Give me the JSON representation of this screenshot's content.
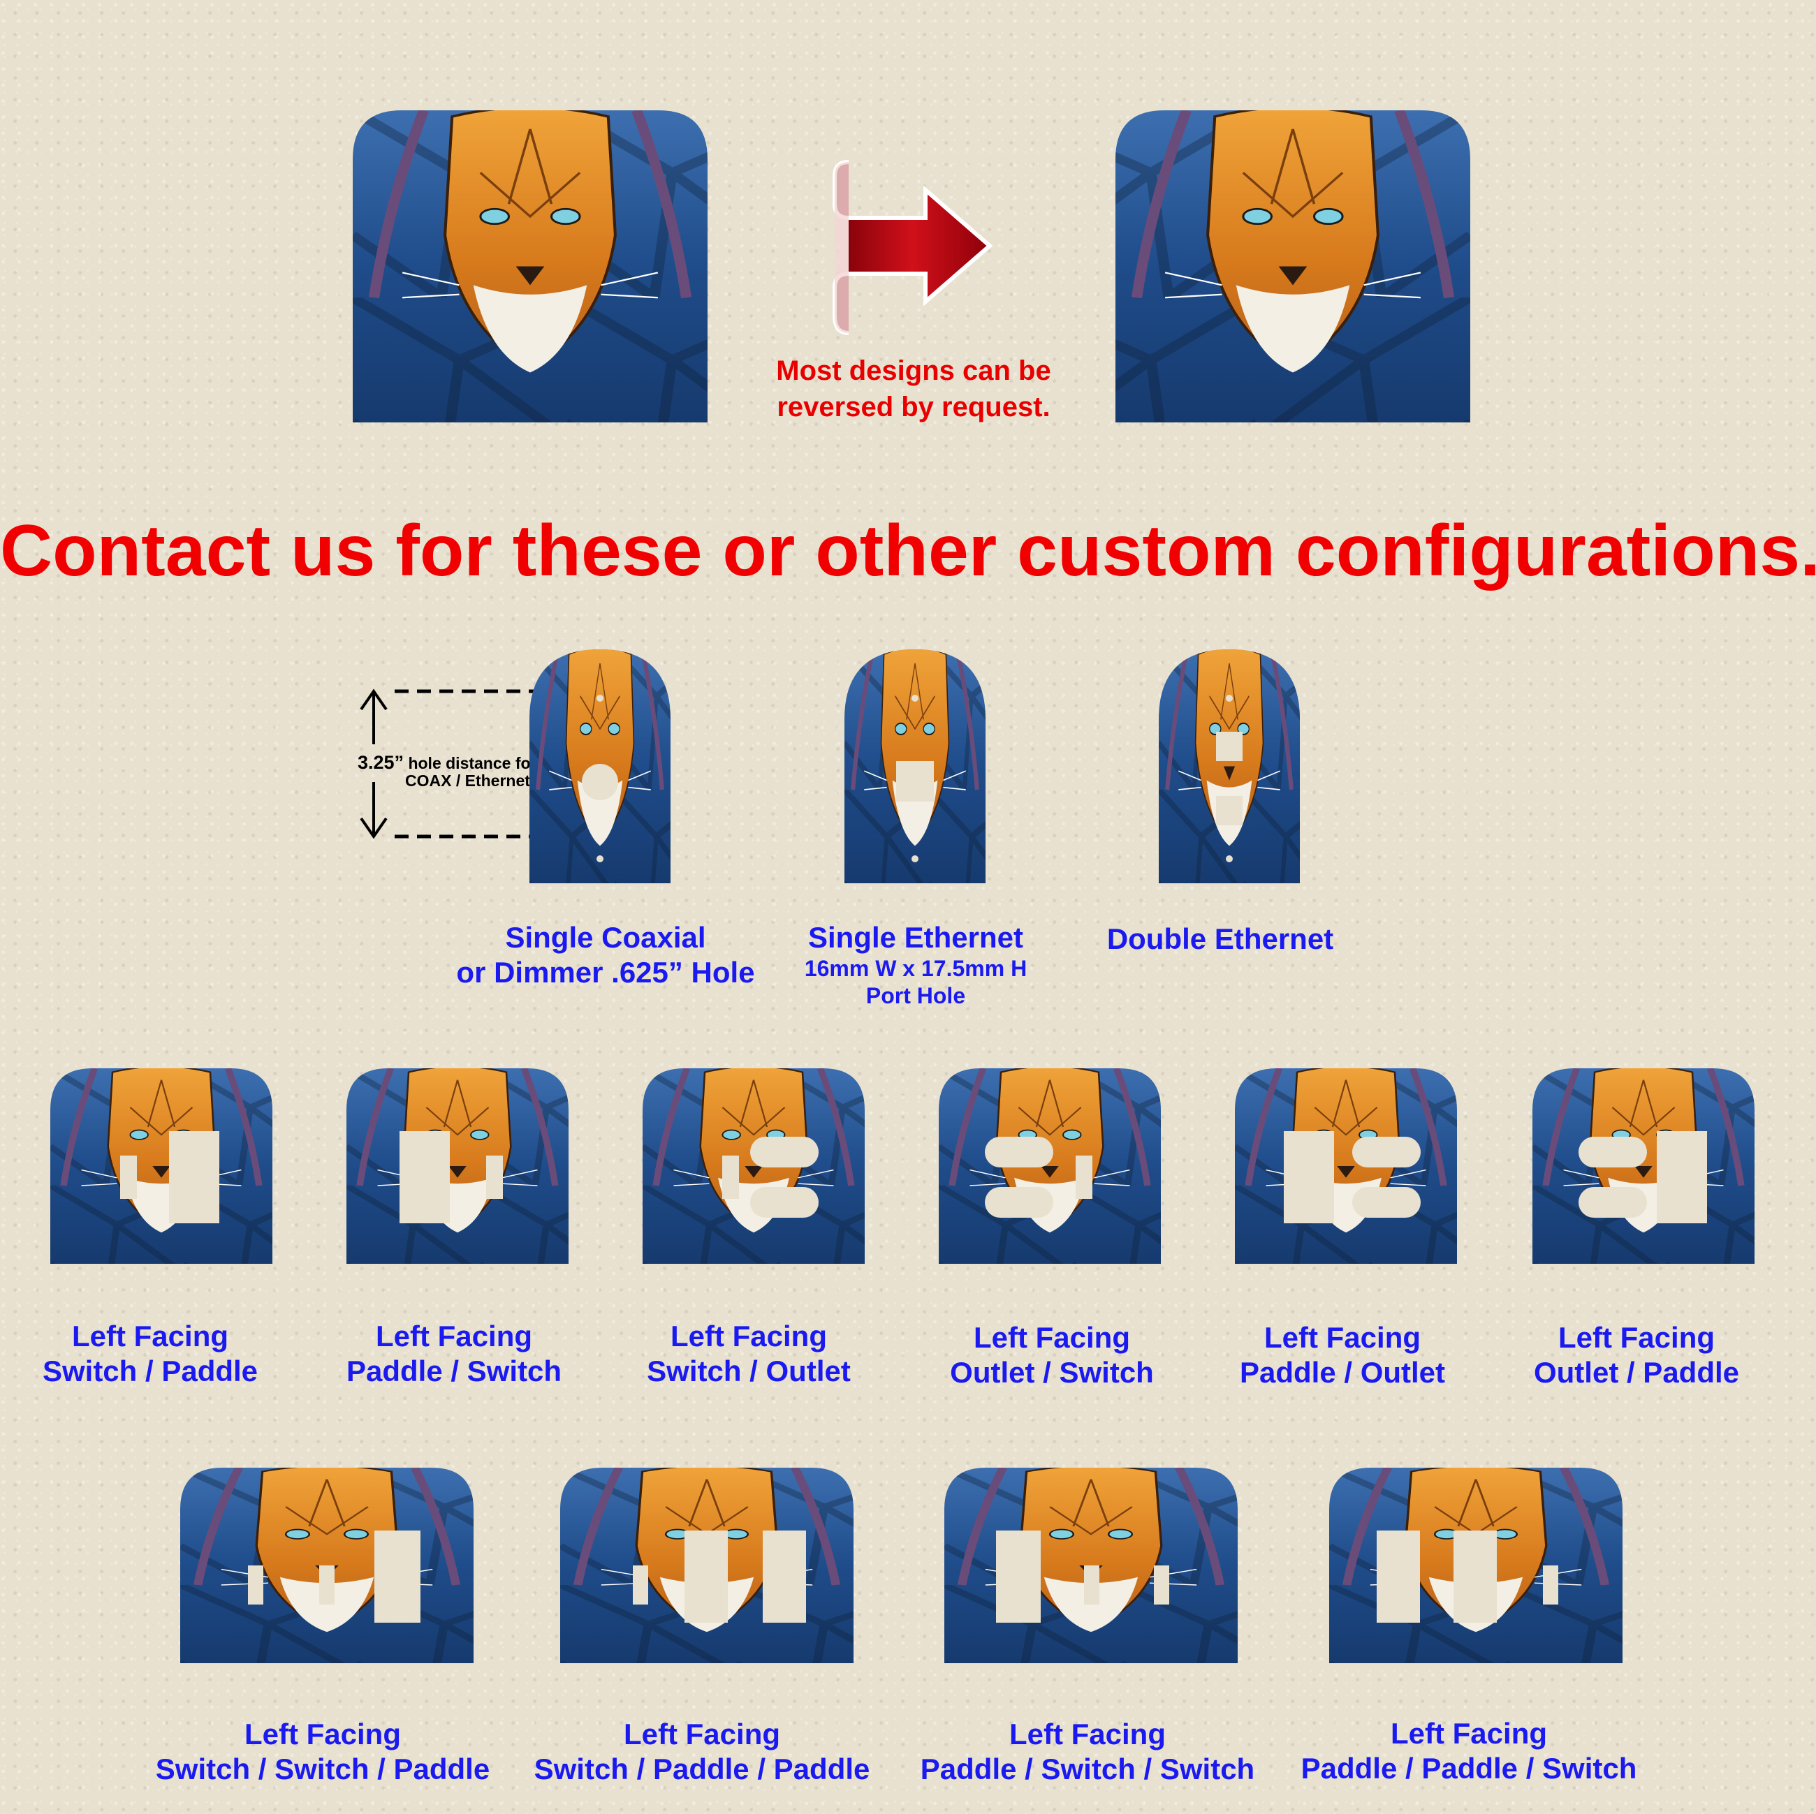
{
  "note": {
    "line1": "Most designs can be",
    "line2": "reversed by request."
  },
  "headline": "Contact us for these or other custom configurations.",
  "dimension": {
    "value": "3.25”",
    "line1": "hole distance for",
    "line2": "COAX / Ethernet"
  },
  "row1": [
    {
      "lines": [
        "Single Coaxial",
        "or Dimmer .625” Hole"
      ]
    },
    {
      "lines": [
        "Single Ethernet"
      ],
      "sub": [
        "16mm W x 17.5mm H",
        "Port Hole"
      ]
    },
    {
      "lines": [
        "Double Ethernet"
      ]
    }
  ],
  "row2": [
    {
      "lines": [
        "Left Facing",
        "Switch / Paddle"
      ]
    },
    {
      "lines": [
        "Left Facing",
        "Paddle / Switch"
      ]
    },
    {
      "lines": [
        "Left Facing",
        "Switch / Outlet"
      ]
    },
    {
      "lines": [
        "Left Facing",
        "Outlet / Switch"
      ]
    },
    {
      "lines": [
        "Left Facing",
        "Paddle / Outlet"
      ]
    },
    {
      "lines": [
        "Left Facing",
        "Outlet / Paddle"
      ]
    }
  ],
  "row3": [
    {
      "lines": [
        "Left Facing",
        "Switch / Switch / Paddle"
      ]
    },
    {
      "lines": [
        "Left Facing",
        "Switch / Paddle / Paddle"
      ]
    },
    {
      "lines": [
        "Left Facing",
        "Paddle / Switch / Switch"
      ]
    },
    {
      "lines": [
        "Left Facing",
        "Paddle / Paddle / Switch"
      ]
    }
  ],
  "colors": {
    "label_blue": "#1a1af0",
    "headline_red": "#f00000",
    "arrow_red": "#b5000d",
    "mane_blue": "#22508f",
    "lion_orange": "#e08a22"
  },
  "icons": [
    "lion-face-art",
    "red-curved-arrow-icon",
    "dimension-arrow-icon"
  ]
}
